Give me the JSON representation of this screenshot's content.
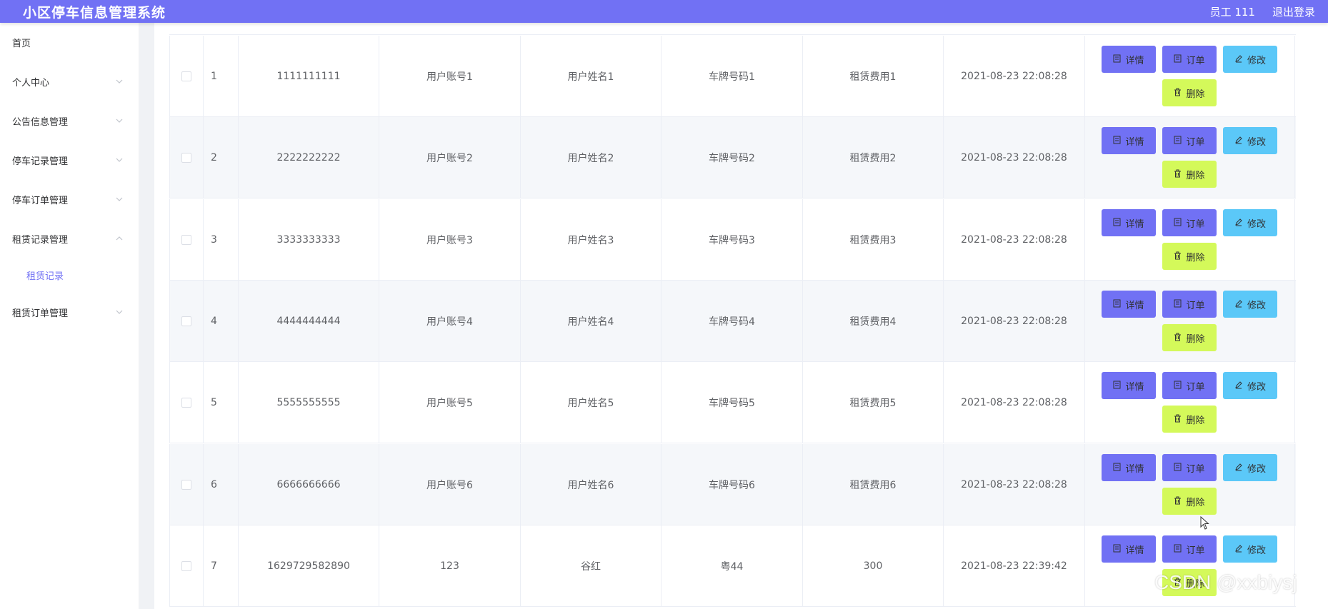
{
  "header": {
    "title": "小区停车信息管理系统",
    "user": "员工 111",
    "logout": "退出登录"
  },
  "sidebar": {
    "items": [
      {
        "label": "首页"
      },
      {
        "label": "个人中心"
      },
      {
        "label": "公告信息管理"
      },
      {
        "label": "停车记录管理"
      },
      {
        "label": "停车订单管理"
      },
      {
        "label": "租赁记录管理"
      },
      {
        "label": "租赁记录"
      },
      {
        "label": "租赁订单管理"
      }
    ]
  },
  "buttons": {
    "detail": "详情",
    "order": "订单",
    "edit": "修改",
    "delete": "删除"
  },
  "rows": [
    {
      "idx": "1",
      "c1": "1111111111",
      "c2": "用户账号1",
      "c3": "用户姓名1",
      "c4": "车牌号码1",
      "c5": "租赁费用1",
      "c6": "2021-08-23 22:08:28"
    },
    {
      "idx": "2",
      "c1": "2222222222",
      "c2": "用户账号2",
      "c3": "用户姓名2",
      "c4": "车牌号码2",
      "c5": "租赁费用2",
      "c6": "2021-08-23 22:08:28"
    },
    {
      "idx": "3",
      "c1": "3333333333",
      "c2": "用户账号3",
      "c3": "用户姓名3",
      "c4": "车牌号码3",
      "c5": "租赁费用3",
      "c6": "2021-08-23 22:08:28"
    },
    {
      "idx": "4",
      "c1": "4444444444",
      "c2": "用户账号4",
      "c3": "用户姓名4",
      "c4": "车牌号码4",
      "c5": "租赁费用4",
      "c6": "2021-08-23 22:08:28"
    },
    {
      "idx": "5",
      "c1": "5555555555",
      "c2": "用户账号5",
      "c3": "用户姓名5",
      "c4": "车牌号码5",
      "c5": "租赁费用5",
      "c6": "2021-08-23 22:08:28"
    },
    {
      "idx": "6",
      "c1": "6666666666",
      "c2": "用户账号6",
      "c3": "用户姓名6",
      "c4": "车牌号码6",
      "c5": "租赁费用6",
      "c6": "2021-08-23 22:08:28"
    },
    {
      "idx": "7",
      "c1": "1629729582890",
      "c2": "123",
      "c3": "谷红",
      "c4": "粤44",
      "c5": "300",
      "c6": "2021-08-23 22:39:42"
    }
  ],
  "watermark": "CSDN @xxbiysj",
  "colors": {
    "primary": "#7171f4",
    "info": "#5bc8f8",
    "danger": "#d4f95a"
  }
}
